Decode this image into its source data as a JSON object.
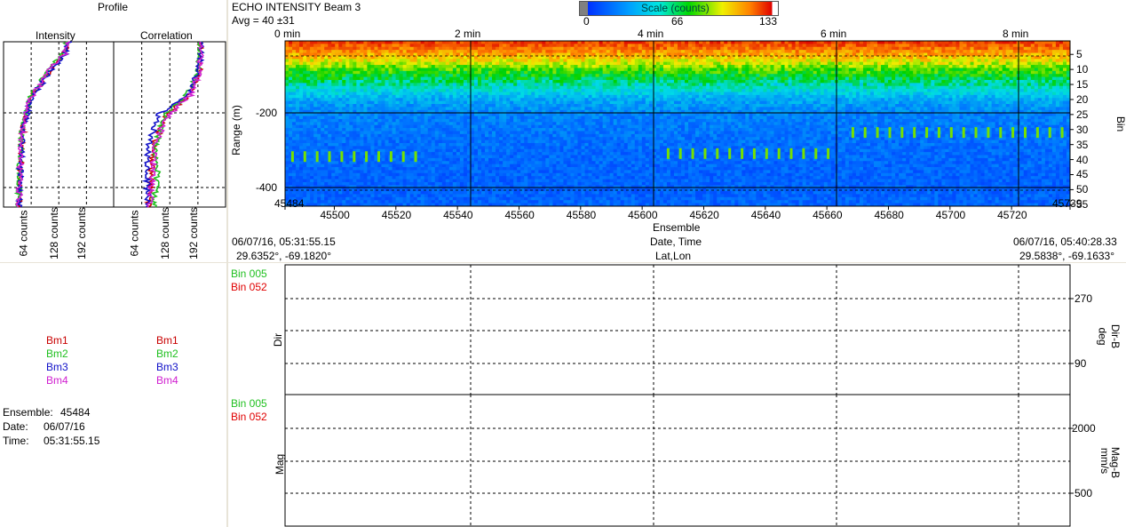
{
  "profile": {
    "title": "Profile",
    "intensity_label": "Intensity",
    "correlation_label": "Correlation",
    "intensity_ticks": [
      "64 counts",
      "128 counts",
      "192 counts"
    ],
    "correlation_ticks": [
      "64 counts",
      "128 counts",
      "192 counts"
    ],
    "legend_left": [
      "Bm1",
      "Bm2",
      "Bm3",
      "Bm4"
    ],
    "legend_right": [
      "Bm1",
      "Bm2",
      "Bm3",
      "Bm4"
    ]
  },
  "beam_colors": [
    "#c80000",
    "#20c020",
    "#1010c8",
    "#d020d0"
  ],
  "info": {
    "ensemble_label": "Ensemble:",
    "ensemble_value": "45484",
    "date_label": "Date:",
    "date_value": "06/07/16",
    "time_label": "Time:",
    "time_value": "05:31:55.15"
  },
  "echo": {
    "title": "ECHO INTENSITY Beam 3",
    "avg": "Avg = 40 ±31",
    "scale_title": "Scale (counts)",
    "scale_ticks": [
      "0",
      "66",
      "133"
    ],
    "time_ticks": [
      "0 min",
      "2 min",
      "4 min",
      "6 min",
      "8 min"
    ],
    "range_label": "Range (m)",
    "range_ticks": [
      "-200",
      "-400"
    ],
    "bin_label": "Bin",
    "bin_ticks": [
      "5",
      "10",
      "15",
      "20",
      "25",
      "30",
      "35",
      "40",
      "45",
      "50",
      "55"
    ],
    "ensemble_ticks": [
      "45484",
      "45500",
      "45520",
      "45540",
      "45560",
      "45580",
      "45600",
      "45620",
      "45640",
      "45660",
      "45680",
      "45700",
      "45720",
      "45739"
    ],
    "ensemble_label": "Ensemble",
    "date_time_label": "Date, Time",
    "lat_lon_label": "Lat,Lon",
    "start_datetime": "06/07/16, 05:31:55.15",
    "end_datetime": "06/07/16, 05:40:28.33",
    "start_latlon": "29.6352°, -69.1820°",
    "end_latlon": "29.5838°, -69.1633°"
  },
  "dir_panel": {
    "legend": [
      "Bin 005",
      "Bin 052"
    ],
    "legend_colors": [
      "#20c020",
      "#e00000"
    ],
    "side_label": "Dir",
    "right_label": "Dir-B",
    "right_unit": "deg",
    "ticks": [
      "270",
      "90"
    ]
  },
  "mag_panel": {
    "legend": [
      "Bin 005",
      "Bin 052"
    ],
    "legend_colors": [
      "#20c020",
      "#e00000"
    ],
    "side_label": "Mag",
    "right_label": "Mag-B",
    "right_unit": "mm/s",
    "ticks": [
      "2000",
      "500"
    ]
  },
  "chart_data": [
    {
      "type": "heatmap",
      "title": "ECHO INTENSITY Beam 3",
      "subtitle": "Avg = 40 ±31",
      "xlabel": "Ensemble",
      "ylabel": "Range (m)",
      "xlim": [
        45484,
        45739
      ],
      "bin_range": [
        1,
        55
      ],
      "color_scale": {
        "label": "Scale (counts)",
        "min": 0,
        "mid": 66,
        "max": 133
      },
      "intensity_by_bin": [
        {
          "bin": 1,
          "counts": 120
        },
        {
          "bin": 5,
          "counts": 100
        },
        {
          "bin": 10,
          "counts": 70
        },
        {
          "bin": 15,
          "counts": 50
        },
        {
          "bin": 20,
          "counts": 35
        },
        {
          "bin": 25,
          "counts": 28
        },
        {
          "bin": 35,
          "counts": 24
        },
        {
          "bin": 45,
          "counts": 22
        },
        {
          "bin": 55,
          "counts": 22
        }
      ],
      "target_marks": [
        {
          "ensemble_start": 45486,
          "ensemble_end": 45527,
          "bin": 39,
          "counts": 75
        },
        {
          "ensemble_start": 45608,
          "ensemble_end": 45661,
          "bin": 38,
          "counts": 75
        },
        {
          "ensemble_start": 45668,
          "ensemble_end": 45739,
          "bin": 31,
          "counts": 75
        }
      ]
    },
    {
      "type": "line",
      "title": "Intensity",
      "xlabel": "counts",
      "xlim": [
        0,
        255
      ],
      "series_profile_counts": [
        {
          "name": "Bm1",
          "bin_values": [
            [
              1,
              150
            ],
            [
              5,
              140
            ],
            [
              10,
              110
            ],
            [
              20,
              60
            ],
            [
              30,
              45
            ],
            [
              40,
              40
            ],
            [
              50,
              36
            ],
            [
              55,
              36
            ]
          ]
        },
        {
          "name": "Bm2",
          "bin_values": [
            [
              1,
              148
            ],
            [
              5,
              138
            ],
            [
              10,
              105
            ],
            [
              20,
              58
            ],
            [
              30,
              44
            ],
            [
              40,
              38
            ],
            [
              50,
              35
            ],
            [
              55,
              35
            ]
          ]
        },
        {
          "name": "Bm3",
          "bin_values": [
            [
              1,
              152
            ],
            [
              5,
              142
            ],
            [
              10,
              112
            ],
            [
              20,
              62
            ],
            [
              30,
              46
            ],
            [
              40,
              40
            ],
            [
              50,
              37
            ],
            [
              55,
              37
            ]
          ]
        },
        {
          "name": "Bm4",
          "bin_values": [
            [
              1,
              150
            ],
            [
              5,
              141
            ],
            [
              10,
              108
            ],
            [
              20,
              60
            ],
            [
              30,
              45
            ],
            [
              40,
              39
            ],
            [
              50,
              36
            ],
            [
              55,
              36
            ]
          ]
        }
      ]
    },
    {
      "type": "line",
      "title": "Correlation",
      "xlabel": "counts",
      "xlim": [
        0,
        255
      ],
      "series_profile_counts": [
        {
          "name": "Bm1",
          "bin_values": [
            [
              1,
              200
            ],
            [
              10,
              195
            ],
            [
              18,
              175
            ],
            [
              25,
              120
            ],
            [
              35,
              90
            ],
            [
              45,
              85
            ],
            [
              55,
              80
            ]
          ]
        },
        {
          "name": "Bm2",
          "bin_values": [
            [
              1,
              200
            ],
            [
              10,
              192
            ],
            [
              18,
              170
            ],
            [
              25,
              115
            ],
            [
              35,
              95
            ],
            [
              45,
              100
            ],
            [
              55,
              90
            ]
          ]
        },
        {
          "name": "Bm3",
          "bin_values": [
            [
              1,
              200
            ],
            [
              10,
              195
            ],
            [
              18,
              172
            ],
            [
              25,
              100
            ],
            [
              35,
              80
            ],
            [
              45,
              75
            ],
            [
              55,
              80
            ]
          ]
        },
        {
          "name": "Bm4",
          "bin_values": [
            [
              1,
              200
            ],
            [
              10,
              196
            ],
            [
              18,
              178
            ],
            [
              25,
              125
            ],
            [
              35,
              92
            ],
            [
              45,
              88
            ],
            [
              55,
              82
            ]
          ]
        }
      ]
    }
  ]
}
